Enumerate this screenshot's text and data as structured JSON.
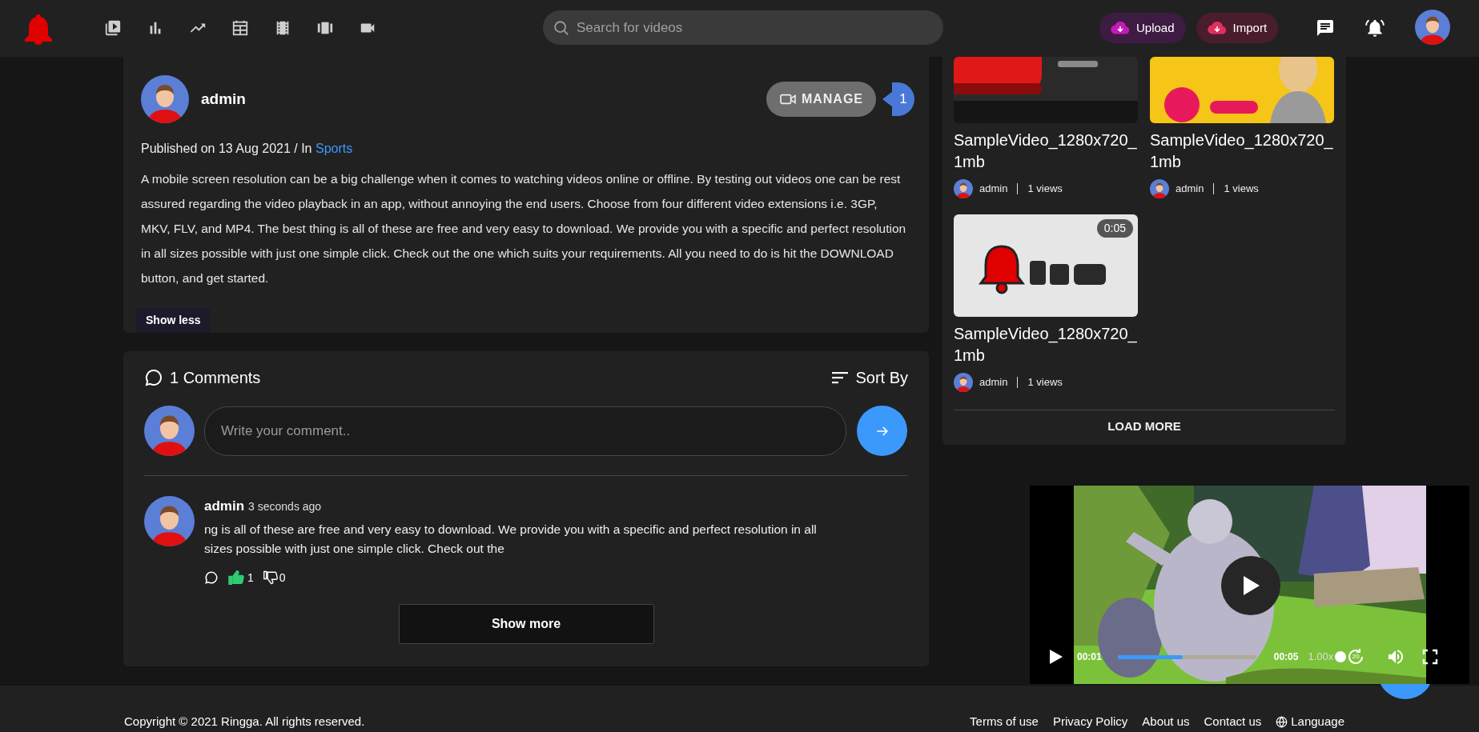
{
  "header": {
    "search": {
      "placeholder": "Search for videos"
    },
    "actions": [
      {
        "label": "Upload",
        "kind": "upload"
      },
      {
        "label": "Import",
        "kind": "import"
      }
    ]
  },
  "video_info": {
    "author": "admin",
    "manage_label": "MANAGE",
    "manage_count": "1",
    "published": "Published on 13 Aug 2021 / In",
    "category": "Sports",
    "description": "A mobile screen resolution can be a big challenge when it comes to watching videos online or offline. By testing out videos one can be rest assured regarding the video playback in an app, without annoying the end users. Choose from four different video extensions i.e. 3GP, MKV, FLV, and MP4. The best thing is all of these are free and very easy to download. We provide you with a specific and perfect resolution in all sizes possible with just one simple click. Check out the one which suits your requirements. All you need to do is hit the DOWNLOAD button, and get started.",
    "toggle": "Show less"
  },
  "comments": {
    "title": "1 Comments",
    "sort_label": "Sort By",
    "input": {
      "placeholder": "Write your comment.."
    },
    "items": [
      {
        "author": "admin",
        "time": "3 seconds ago",
        "text": "ng is all of these are free and very easy to download. We provide you with a specific and perfect resolution in all sizes possible with just one simple click. Check out the",
        "likes": "1",
        "dislikes": "0",
        "liked": true
      }
    ],
    "more": "Show more"
  },
  "related": {
    "videos": [
      {
        "title": "SampleVideo_1280x720_1mb",
        "author": "admin",
        "views": "1 views",
        "kind": "red-play"
      },
      {
        "title": "SampleVideo_1280x720_1mb",
        "author": "admin",
        "views": "1 views",
        "kind": "yellow-poster"
      },
      {
        "title": "SampleVideo_1280x720_1mb",
        "author": "admin",
        "views": "1 views",
        "kind": "bell",
        "duration": "0:05"
      }
    ],
    "load_more": "LOAD MORE"
  },
  "player": {
    "current": "00:01",
    "duration": "00:05",
    "speed": "1.00x",
    "skip": "20",
    "level": 0.47
  },
  "footer": {
    "copyright": "Copyright © 2021 Ringga. All rights reserved.",
    "links": [
      "Terms of use",
      "Privacy Policy",
      "About us",
      "Contact us"
    ],
    "language": "Language"
  }
}
